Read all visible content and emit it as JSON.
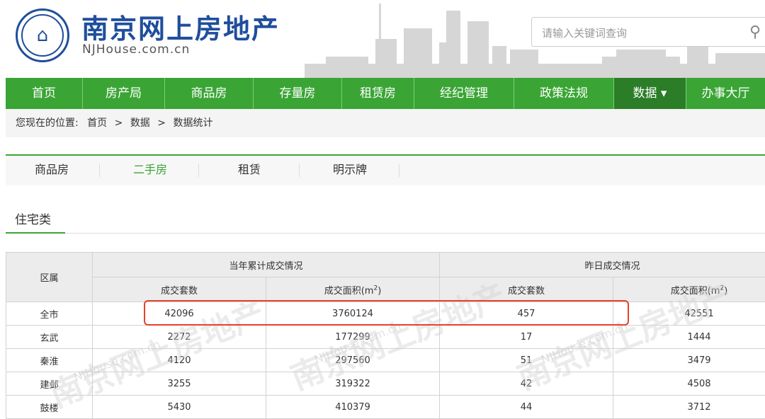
{
  "site": {
    "name": "南京网上房地产",
    "domain": "NJHouse.com.cn",
    "search_placeholder": "请输入关键词查询"
  },
  "nav": [
    "首页",
    "房产局",
    "商品房",
    "存量房",
    "租赁房",
    "经纪管理",
    "政策法规",
    "数据 ▾",
    "办事大厅"
  ],
  "breadcrumb": {
    "prefix": "您现在的位置:",
    "home": "首页",
    "sep1": ">",
    "data": "数据",
    "sep2": ">",
    "current": "数据统计"
  },
  "subtabs": [
    "商品房",
    "二手房",
    "租赁",
    "明示牌"
  ],
  "section_title": "住宅类",
  "table": {
    "district_header": "区属",
    "group1": "当年累计成交情况",
    "group2": "昨日成交情况",
    "col_units": "成交套数",
    "col_area": "成交面积(m",
    "area_sup": "2",
    "area_close": ")",
    "rows": [
      {
        "district": "全市",
        "ytd_units": "42096",
        "ytd_area": "3760124",
        "day_units": "457",
        "day_area": "42551"
      },
      {
        "district": "玄武",
        "ytd_units": "2272",
        "ytd_area": "177299",
        "day_units": "17",
        "day_area": "1444"
      },
      {
        "district": "秦淮",
        "ytd_units": "4120",
        "ytd_area": "297560",
        "day_units": "51",
        "day_area": "3479"
      },
      {
        "district": "建邺",
        "ytd_units": "3255",
        "ytd_area": "319322",
        "day_units": "42",
        "day_area": "4508"
      },
      {
        "district": "鼓楼",
        "ytd_units": "5430",
        "ytd_area": "410379",
        "day_units": "44",
        "day_area": "3712"
      }
    ]
  },
  "watermark": {
    "text": "南京网上房地产",
    "domain": "NJHouse.com.cn"
  },
  "colors": {
    "brand_blue": "#1f4e9c",
    "nav_green": "#3aa535",
    "nav_active": "#2b7d27",
    "highlight_red": "#e8412a"
  }
}
